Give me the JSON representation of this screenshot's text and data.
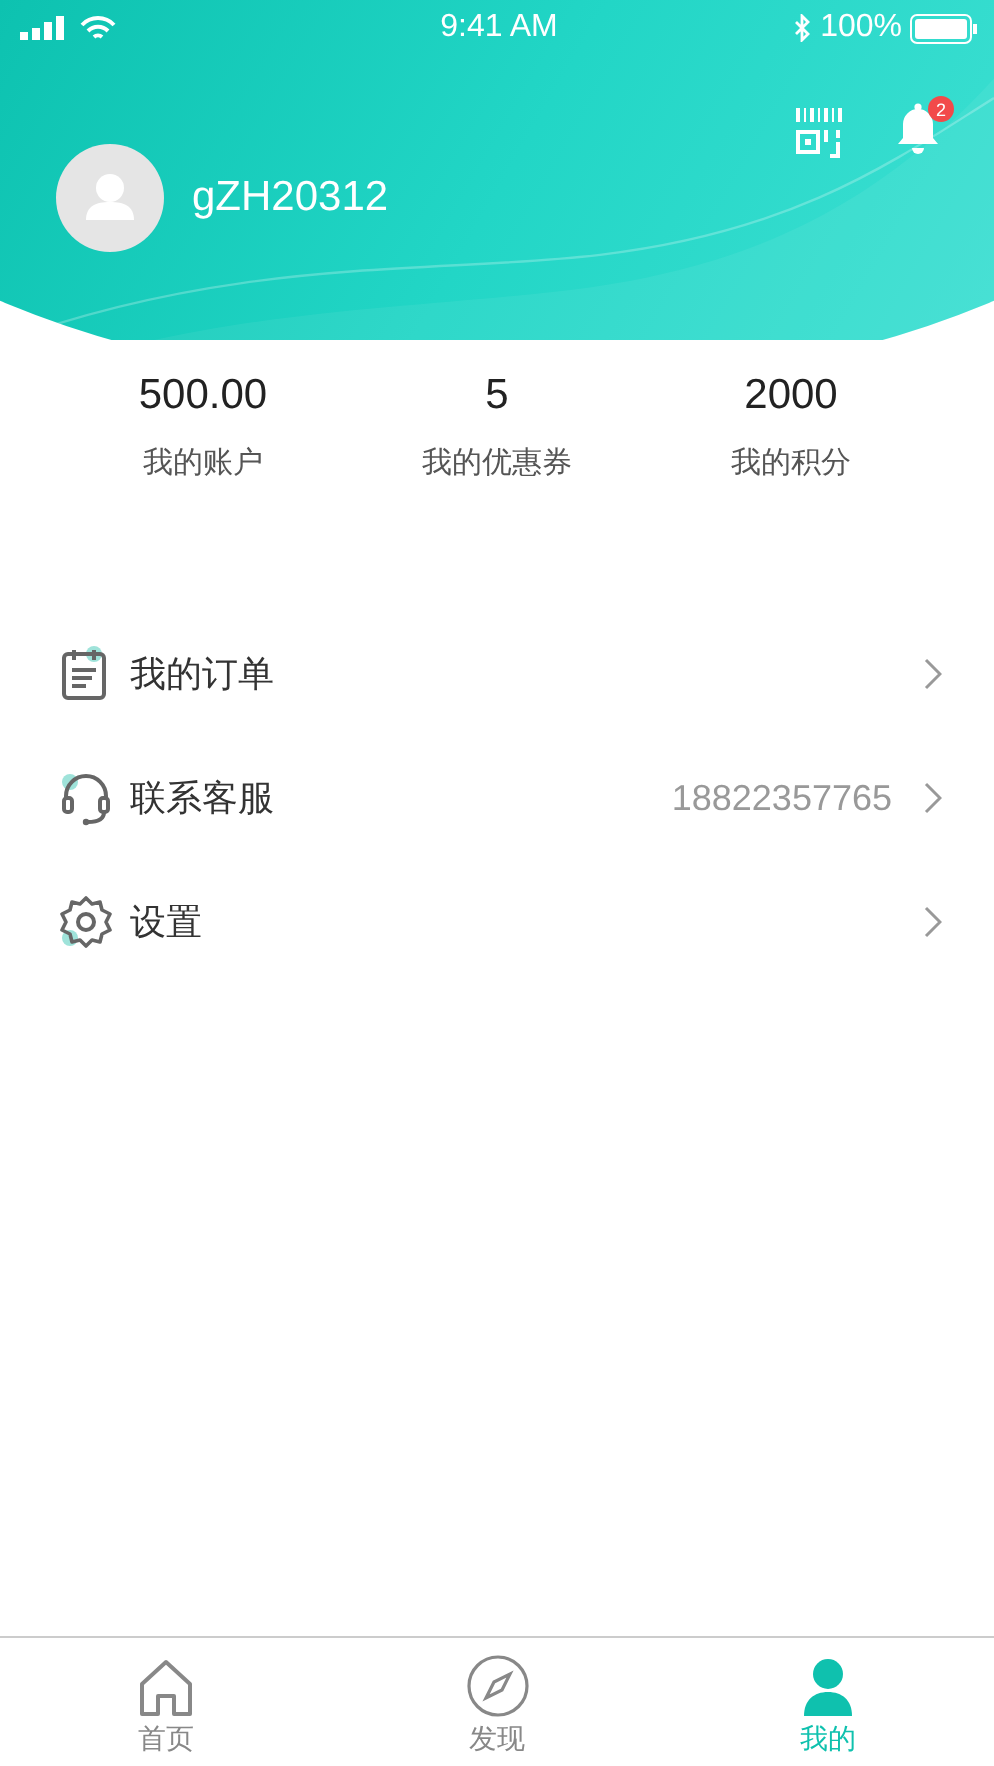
{
  "status_bar": {
    "time": "9:41 AM",
    "battery": "100%"
  },
  "profile": {
    "username": "gZH20312",
    "notification_count": "2"
  },
  "stats": [
    {
      "value": "500.00",
      "label": "我的账户"
    },
    {
      "value": "5",
      "label": "我的优惠券"
    },
    {
      "value": "2000",
      "label": "我的积分"
    }
  ],
  "menu": [
    {
      "kind": "orders",
      "label": "我的订单"
    },
    {
      "kind": "service",
      "label": "联系客服",
      "detail": "18822357765"
    },
    {
      "kind": "settings",
      "label": "设置"
    }
  ],
  "tab_bar": [
    {
      "kind": "home",
      "label": "首页",
      "selected": false
    },
    {
      "kind": "discover",
      "label": "发现",
      "selected": false
    },
    {
      "kind": "me",
      "label": "我的",
      "selected": true
    }
  ]
}
